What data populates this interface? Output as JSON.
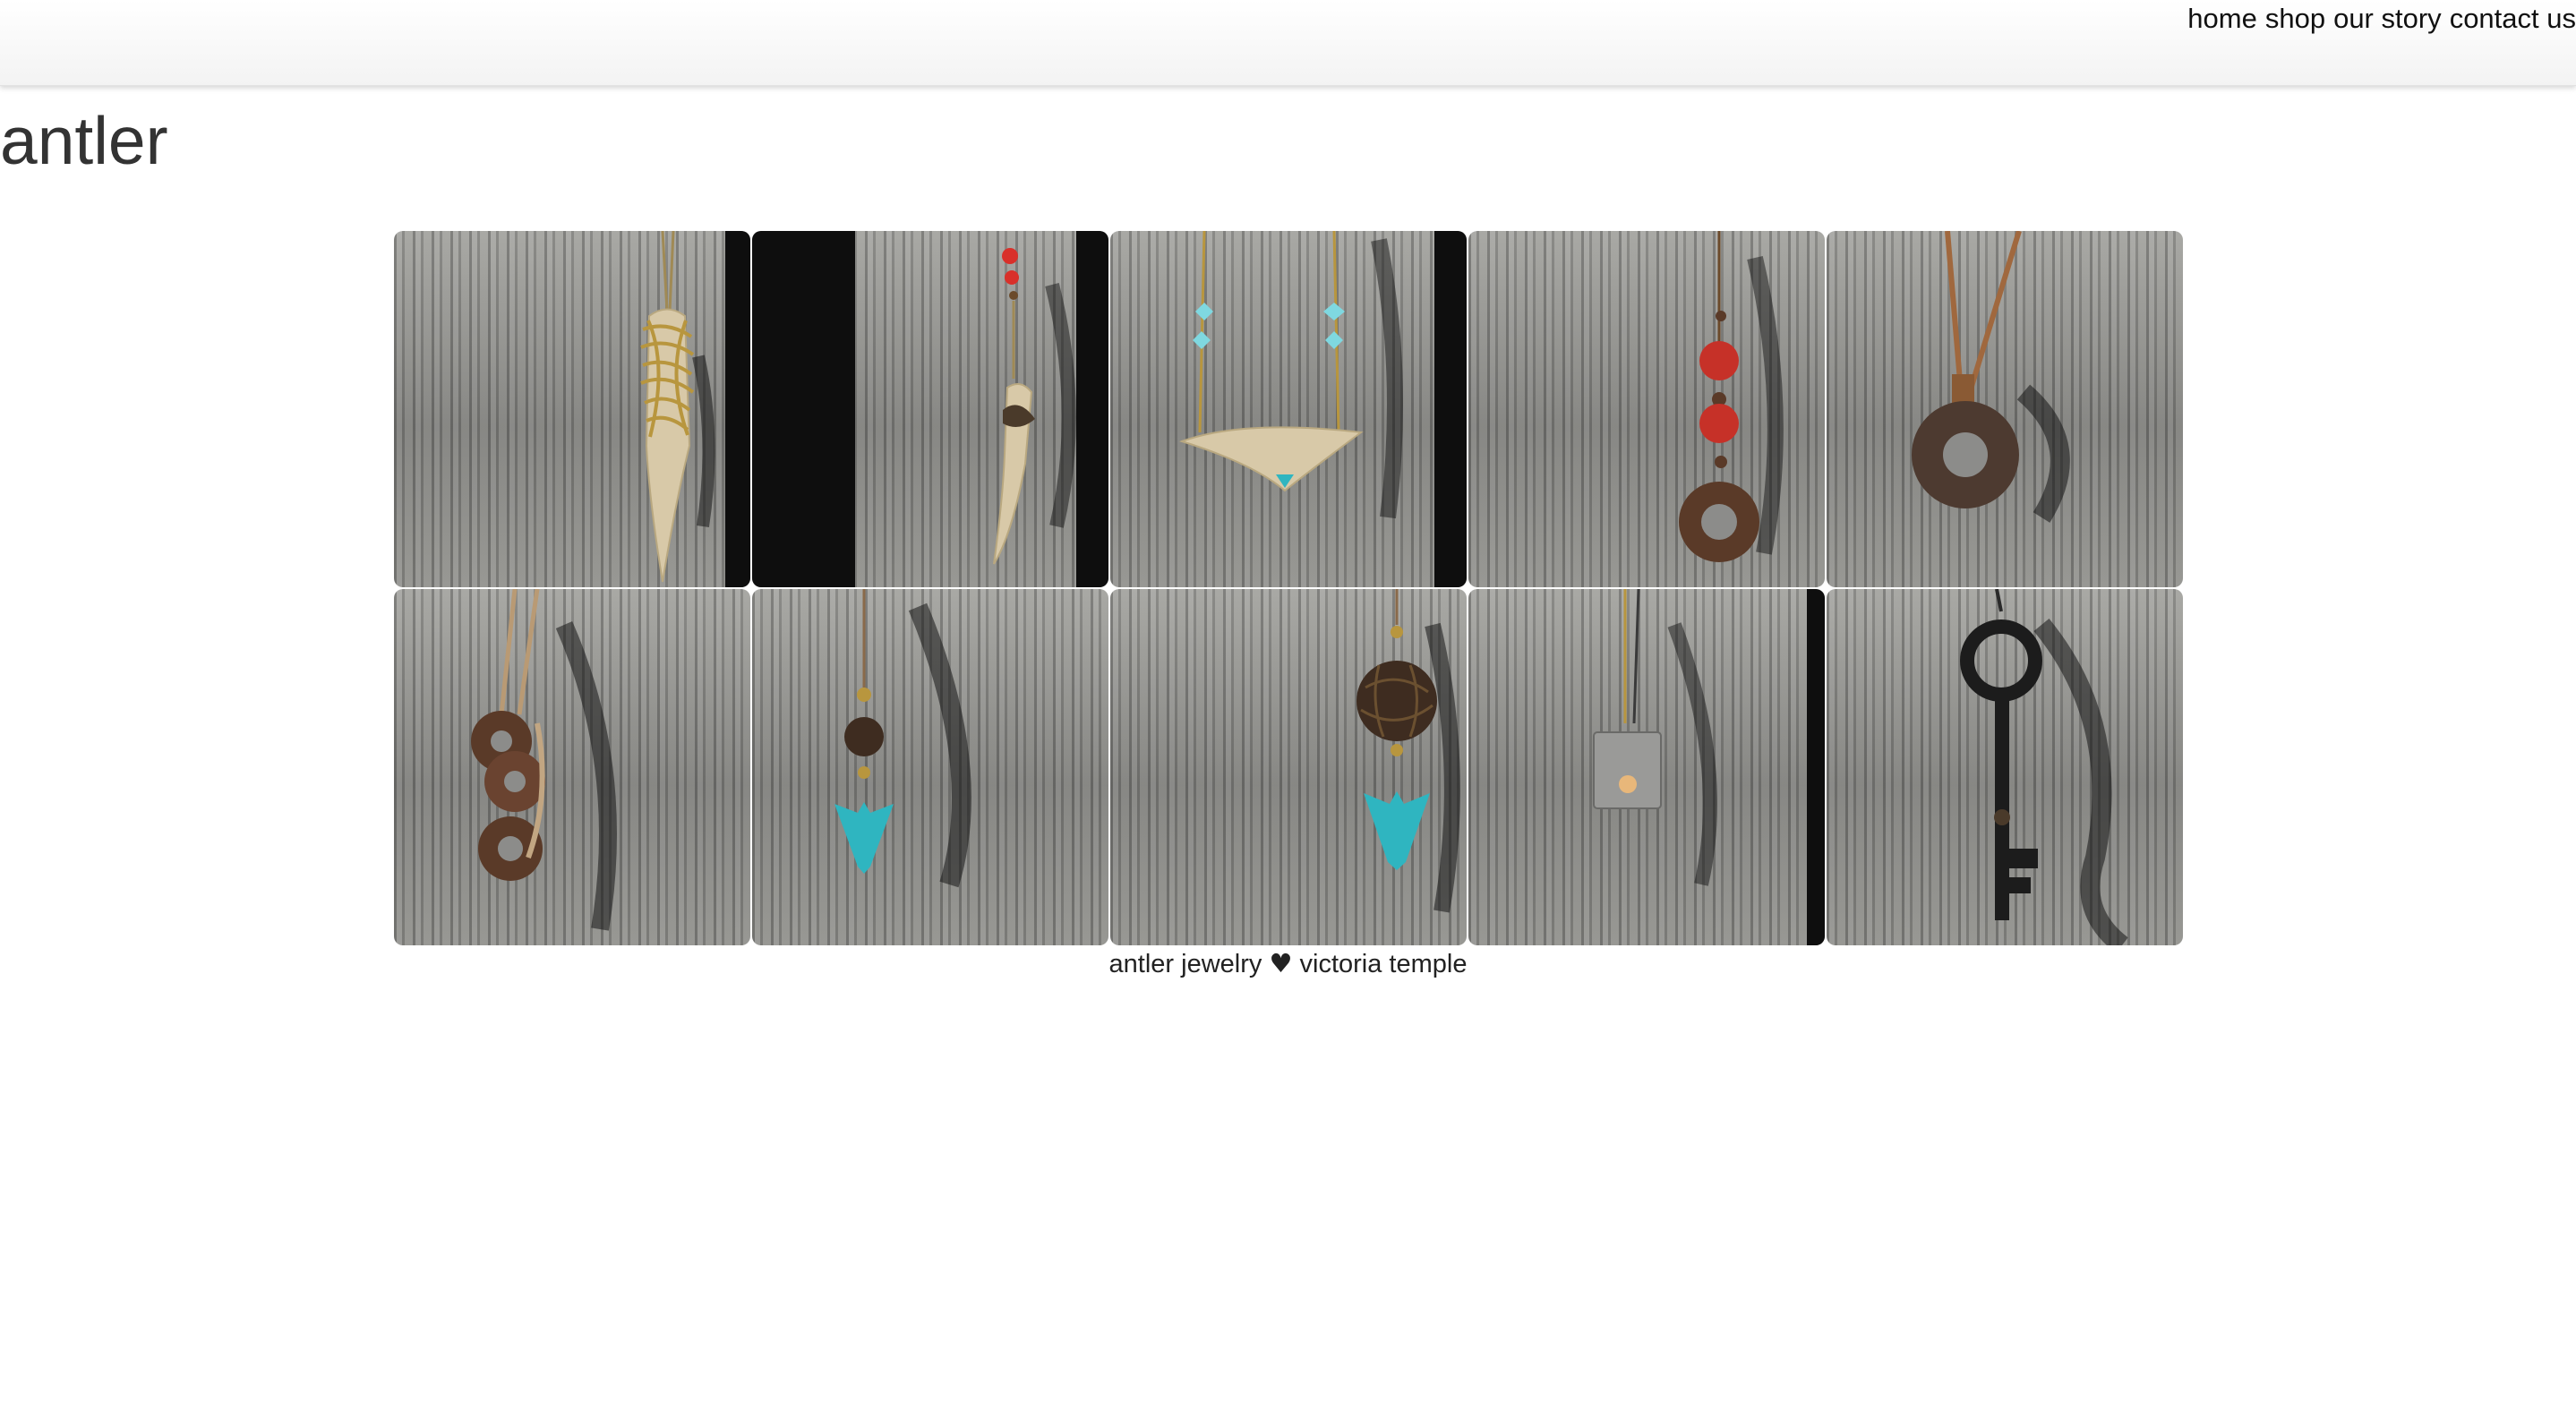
{
  "nav": {
    "items": [
      {
        "label": "home"
      },
      {
        "label": "shop"
      },
      {
        "label": "our story"
      },
      {
        "label": "contact us"
      }
    ]
  },
  "page": {
    "title": "antler"
  },
  "gallery": {
    "items": [
      {
        "icon": "antler-wire-wrapped-pendant-icon"
      },
      {
        "icon": "antler-tip-red-bead-pendant-icon"
      },
      {
        "icon": "antler-bar-turquoise-necklace-icon"
      },
      {
        "icon": "red-bead-washer-pendant-icon"
      },
      {
        "icon": "leather-cord-washer-pendant-icon"
      },
      {
        "icon": "stacked-washer-cord-pendant-icon"
      },
      {
        "icon": "turquoise-heart-bead-pendant-icon"
      },
      {
        "icon": "turquoise-heart-wire-ball-pendant-icon"
      },
      {
        "icon": "square-shell-pearl-pendant-icon"
      },
      {
        "icon": "skeleton-key-pendant-icon"
      }
    ]
  },
  "footer": {
    "text_before": "antler jewelry",
    "heart": "♥",
    "text_after": "victoria temple"
  },
  "colors": {
    "wood": "#8c8c8a",
    "turquoise": "#2fb5c0",
    "red_bead": "#d9302a",
    "rust": "#5a3a28",
    "antler": "#d8c9a8",
    "brass": "#b8963e"
  }
}
